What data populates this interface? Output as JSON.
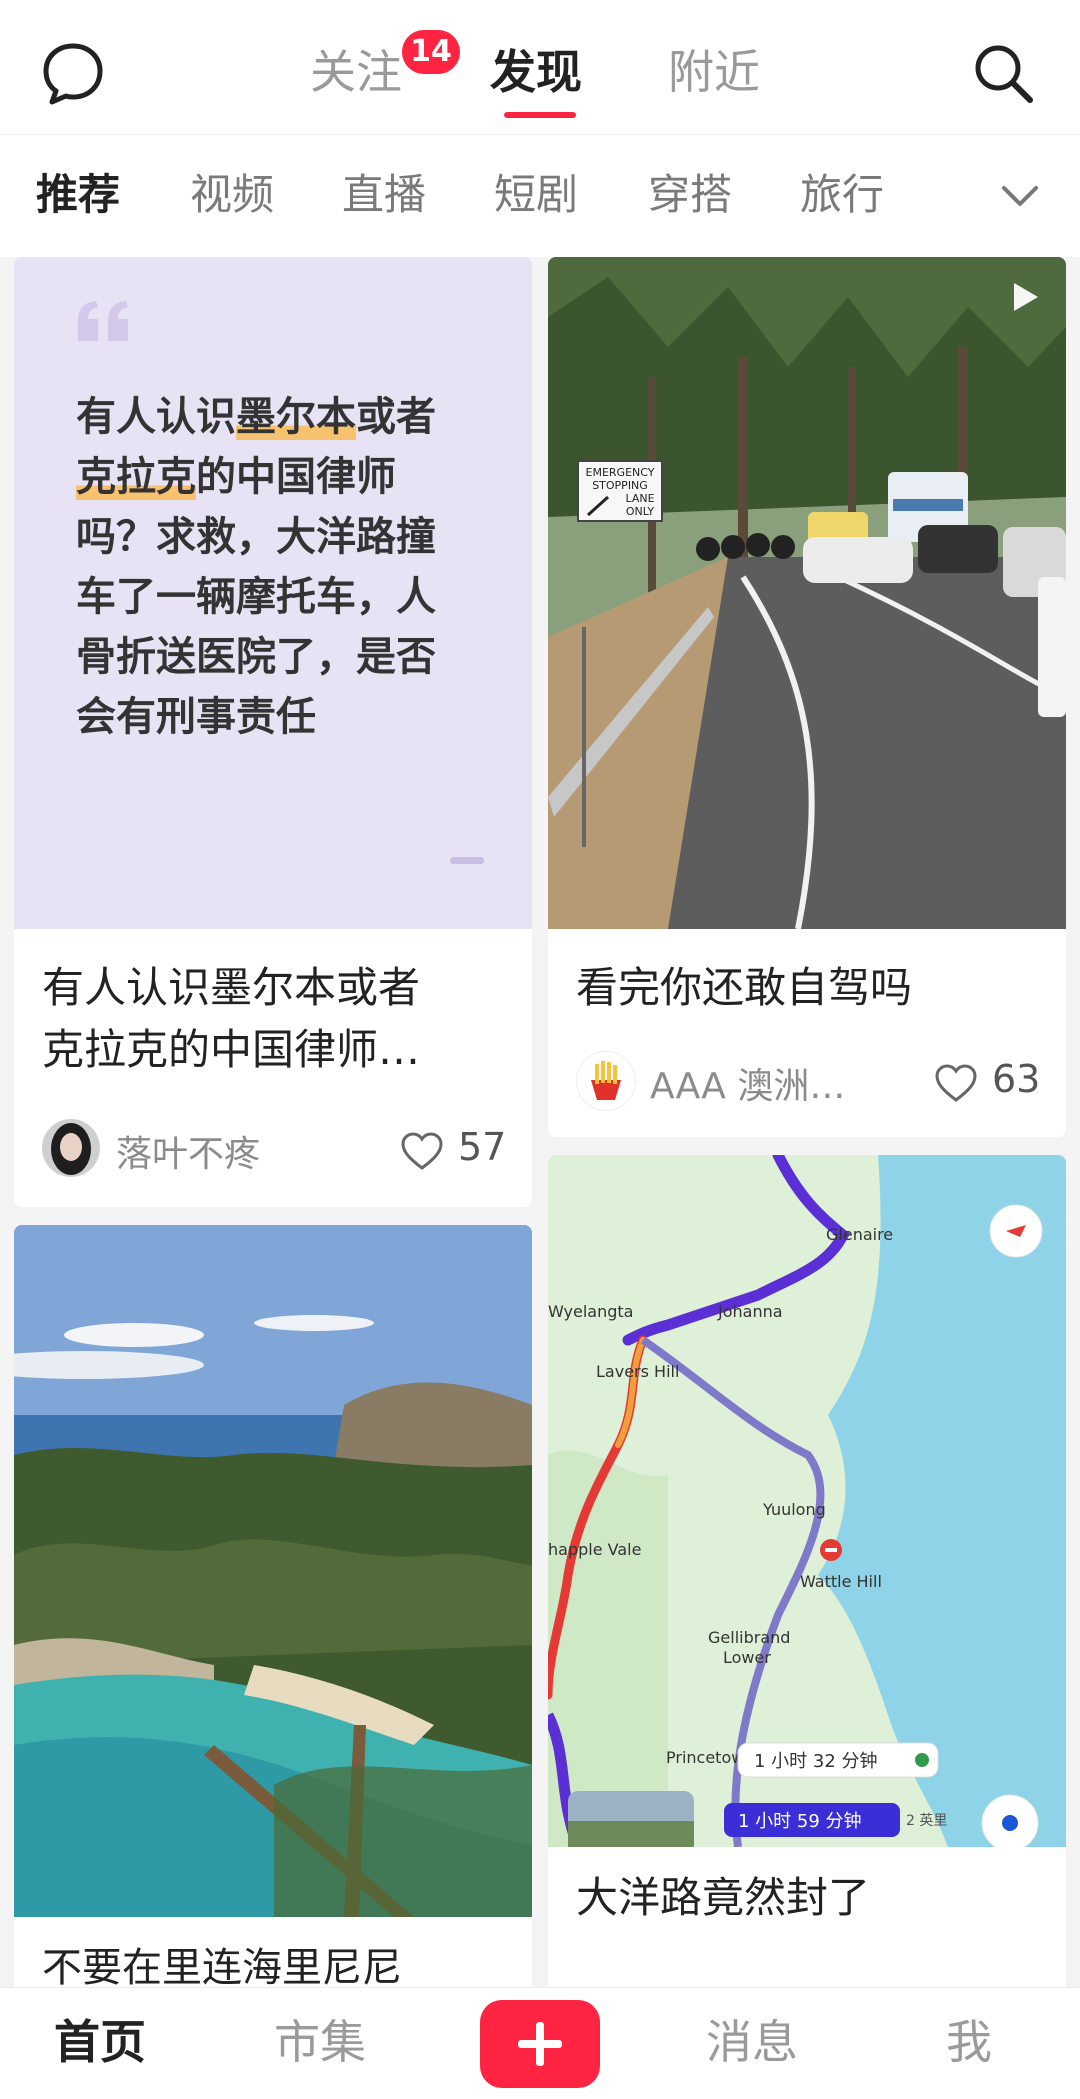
{
  "top_nav": {
    "tabs": [
      {
        "label": "关注",
        "badge": "14"
      },
      {
        "label": "发现"
      },
      {
        "label": "附近"
      }
    ],
    "active_tab": "发现",
    "left_icon": "chat-bubble-icon",
    "right_icon": "search-icon"
  },
  "categories": {
    "items": [
      "推荐",
      "视频",
      "直播",
      "短剧",
      "穿搭",
      "旅行"
    ],
    "active": "推荐",
    "more_icon": "chevron-down-icon"
  },
  "feed": {
    "cards": [
      {
        "quote_lines": [
          [
            {
              "t": "有人认识"
            },
            {
              "t": "墨尔本",
              "hl": true
            },
            {
              "t": "或者"
            }
          ],
          [
            {
              "t": "克拉克",
              "hl": true
            },
            {
              "t": "的中国律师"
            }
          ],
          [
            {
              "t": "吗？求救，大洋路撞"
            }
          ],
          [
            {
              "t": "车了一辆摩托车，人"
            }
          ],
          [
            {
              "t": "骨折送医院了，是否"
            }
          ],
          [
            {
              "t": "会有刑事责任"
            }
          ]
        ],
        "title_line1": "有人认识墨尔本或者",
        "title_line2": "克拉克的中国律师…",
        "author": "落叶不疼",
        "likes": "57"
      },
      {
        "sign_text": [
          "EMERGENCY",
          "STOPPING",
          "LANE",
          "ONLY"
        ],
        "title": "看完你还敢自驾吗",
        "author": "AAA 澳洲…",
        "likes": "63",
        "video_icon": "play-icon"
      },
      {
        "title_partial": "不要在里连海里尼尼"
      },
      {
        "map_labels": [
          "Glenaire",
          "Johanna",
          "Wyelangta",
          "Lavers Hill",
          "Yuulong",
          "happle Vale",
          "Wattle Hill",
          "Gellibrand",
          "Lower",
          "Princetow"
        ],
        "route_badge_1": "1 小时 32 分钟",
        "route_badge_2": "1 小时 59 分钟",
        "scale_1": "2 英里",
        "title": "大洋路竟然封了"
      }
    ]
  },
  "bottom_nav": {
    "items": [
      "首页",
      "市集",
      "消息",
      "我"
    ],
    "active": "首页",
    "add_icon": "plus-icon"
  },
  "colors": {
    "accent": "#ff2442",
    "quote_bg": "#e8e3f4",
    "highlight": "#f7c26e"
  }
}
